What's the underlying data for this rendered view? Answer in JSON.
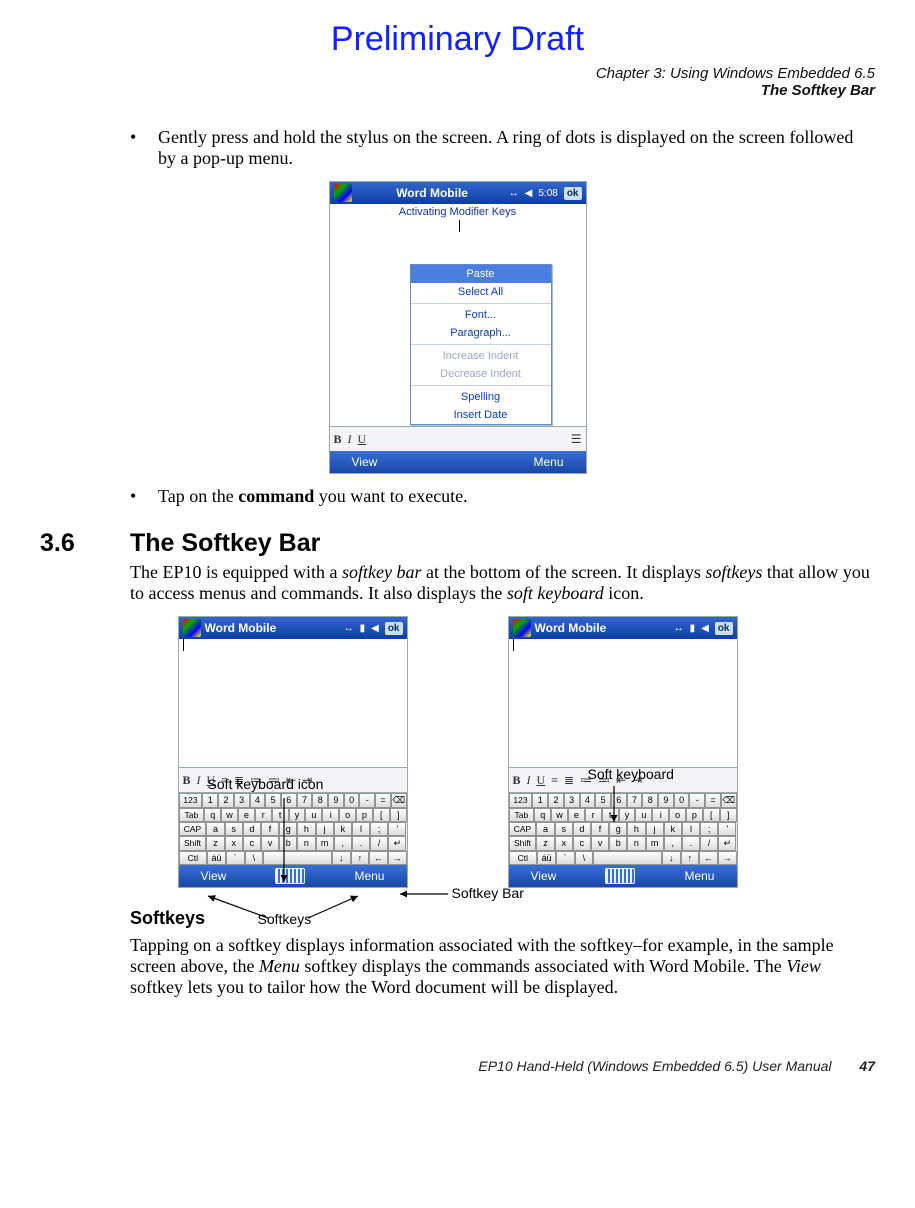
{
  "watermark": "Preliminary Draft",
  "chapter": "Chapter 3:  Using Windows Embedded 6.5",
  "section_header": "The Softkey Bar",
  "bullet1": "Gently press and hold the stylus on the screen. A ring of dots is displayed on the screen followed by a pop-up menu.",
  "bullet2_pre": "Tap on the ",
  "bullet2_bold": "command",
  "bullet2_post": " you want to execute.",
  "sec_num": "3.6",
  "sec_title": "The Softkey Bar",
  "sec_para_1": "The EP10 is equipped with a ",
  "sec_term_1": "softkey bar",
  "sec_para_2": " at the bottom of the screen. It displays ",
  "sec_term_2": "softkeys",
  "sec_para_3": " that allow you to access menus and commands. It also displays the ",
  "sec_term_3": "soft keyboard",
  "sec_para_4": " icon.",
  "screenshot1": {
    "title": "Word Mobile",
    "time": "5:08",
    "ok": "ok",
    "typed": "Activating Modifier Keys",
    "menu": {
      "paste": "Paste",
      "selectall": "Select All",
      "font": "Font...",
      "paragraph": "Paragraph...",
      "inc": "Increase Indent",
      "dec": "Decrease Indent",
      "spell": "Spelling",
      "insdate": "Insert Date"
    },
    "view": "View",
    "menu_btn": "Menu"
  },
  "screenshot2": {
    "title": "Word Mobile",
    "ok": "ok",
    "view": "View",
    "menu_btn": "Menu"
  },
  "osk": {
    "r1": [
      "123",
      "1",
      "2",
      "3",
      "4",
      "5",
      "6",
      "7",
      "8",
      "9",
      "0",
      "-",
      "=",
      "⌫"
    ],
    "r2": [
      "Tab",
      "q",
      "w",
      "e",
      "r",
      "t",
      "y",
      "u",
      "i",
      "o",
      "p",
      "[",
      "]"
    ],
    "r3": [
      "CAP",
      "a",
      "s",
      "d",
      "f",
      "g",
      "h",
      "j",
      "k",
      "l",
      ";",
      "'"
    ],
    "r4": [
      "Shift",
      "z",
      "x",
      "c",
      "v",
      "b",
      "n",
      "m",
      ",",
      ".",
      "/",
      "↵"
    ],
    "r5": [
      "Ctl",
      "áü",
      "`",
      "\\",
      " ",
      "↓",
      "↑",
      "←",
      "→"
    ]
  },
  "callouts": {
    "skb_icon": "Soft keyboard icon",
    "softkeys": "Softkeys",
    "softkey_bar": "Softkey Bar",
    "soft_keyboard": "Soft keyboard"
  },
  "subhead": "Softkeys",
  "softkeys_para_1": "Tapping on a softkey displays information associated with the softkey–for example, in the sample screen above, the ",
  "softkeys_em_1": "Menu",
  "softkeys_para_2": " softkey displays the commands associated with Word Mobile. The ",
  "softkeys_em_2": "View",
  "softkeys_para_3": " softkey lets you to tailor how the Word document will be displayed.",
  "footer_text": "EP10 Hand-Held (Windows Embedded 6.5) User Manual",
  "page_number": "47",
  "fmt": {
    "b": "B",
    "i": "I",
    "u": "U"
  }
}
